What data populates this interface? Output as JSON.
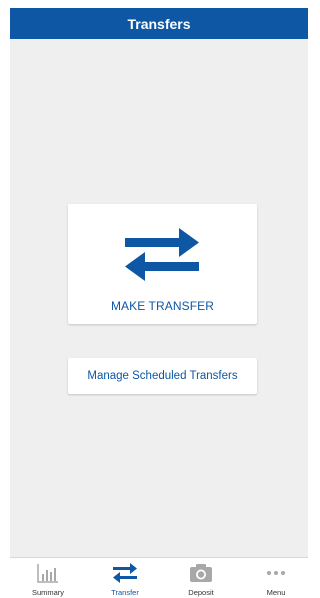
{
  "header": {
    "title": "Transfers"
  },
  "actions": {
    "make_transfer_label": "MAKE TRANSFER",
    "manage_scheduled_label": "Manage Scheduled Transfers"
  },
  "tabbar": {
    "active": "Transfer",
    "items": [
      {
        "label": "Summary",
        "icon": "bar-chart-icon"
      },
      {
        "label": "Transfer",
        "icon": "transfer-arrows-icon"
      },
      {
        "label": "Deposit",
        "icon": "camera-icon"
      },
      {
        "label": "Menu",
        "icon": "more-dots-icon"
      }
    ]
  },
  "colors": {
    "brand": "#0d57a5",
    "background": "#efefef",
    "inactive_icon": "#a8a8a8"
  }
}
